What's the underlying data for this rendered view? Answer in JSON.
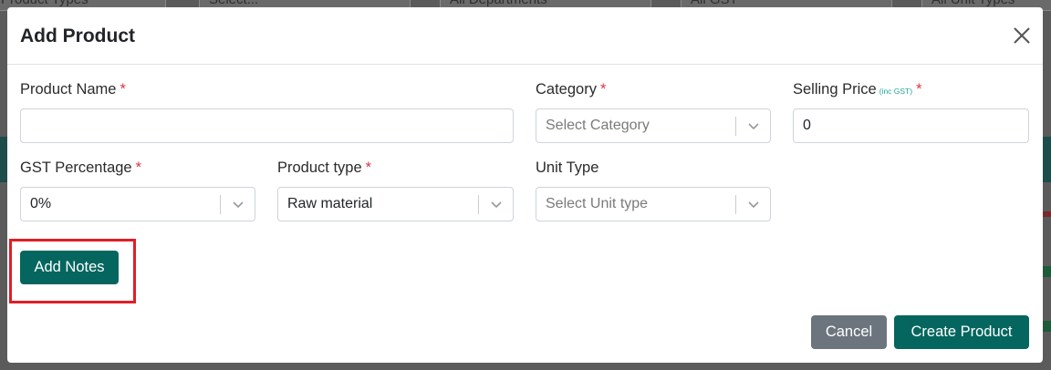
{
  "background": {
    "filters": [
      "Product Types",
      "Select...",
      "All Departments",
      "All GST",
      "All Unit Types"
    ]
  },
  "modal": {
    "title": "Add Product",
    "close_icon": "close-icon",
    "fields": {
      "product_name": {
        "label": "Product Name",
        "required_mark": "*",
        "value": ""
      },
      "category": {
        "label": "Category",
        "required_mark": "*",
        "placeholder": "Select Category"
      },
      "selling_price": {
        "label": "Selling Price",
        "sub_label": "(inc GST)",
        "required_mark": "*",
        "value": "0"
      },
      "gst_percentage": {
        "label": "GST Percentage",
        "required_mark": "*",
        "value": "0%"
      },
      "product_type": {
        "label": "Product type",
        "required_mark": "*",
        "value": "Raw material"
      },
      "unit_type": {
        "label": "Unit Type",
        "placeholder": "Select Unit type"
      }
    },
    "buttons": {
      "add_notes": "Add Notes",
      "cancel": "Cancel",
      "create_product": "Create Product"
    }
  },
  "colors": {
    "primary": "#05665f",
    "secondary": "#6c757d",
    "required": "#dc3545",
    "highlight": "#e01e26",
    "sub_label": "#27a3a3"
  }
}
